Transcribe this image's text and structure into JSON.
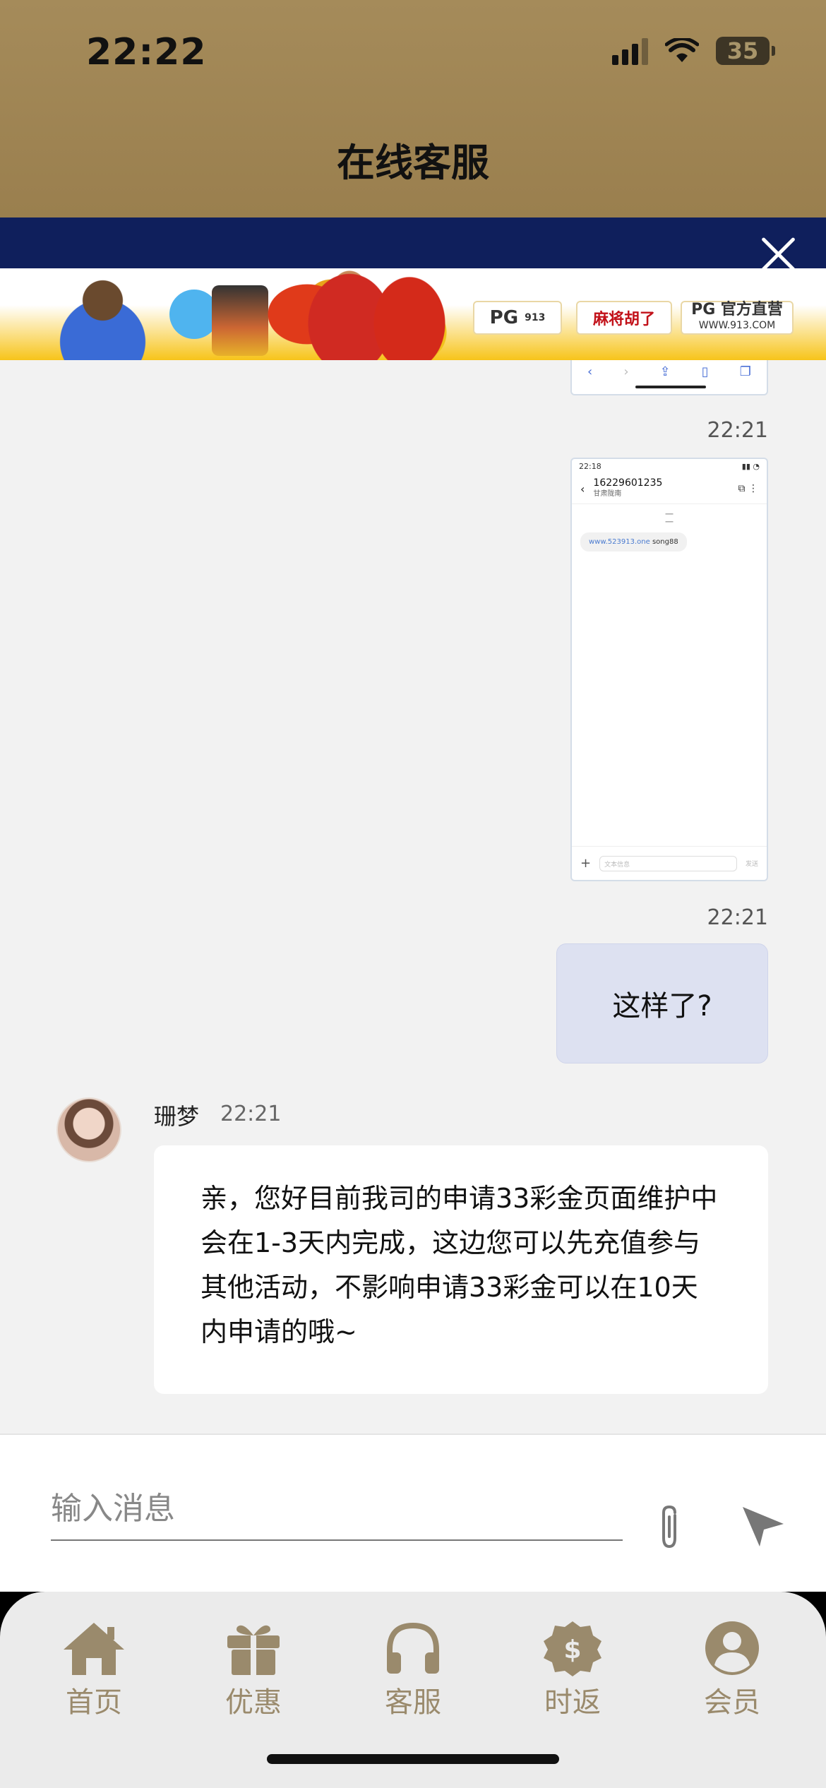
{
  "status_bar": {
    "time": "22:22",
    "battery": "35"
  },
  "header": {
    "title": "在线客服"
  },
  "banner": {
    "tag1": "PG",
    "tag1_sub": "913",
    "tag2": "麻将胡了",
    "tag3": "PG 官方直营",
    "tag3_sub": "WWW.913.COM"
  },
  "chat": {
    "messages": [
      {
        "type": "image",
        "time": "22:21",
        "screenshot": {
          "status_time": "22:18",
          "number": "16229601235",
          "location": "甘肃陇南",
          "link": "www.523913.one",
          "code": "song88",
          "input_placeholder": "文本信息",
          "send": "发送"
        }
      },
      {
        "type": "text",
        "direction": "out",
        "time": "22:21",
        "text": "这样了?"
      },
      {
        "type": "text",
        "direction": "in",
        "sender": "珊梦",
        "time": "22:21",
        "text": "亲，您好目前我司的申请33彩金页面维护中会在1-3天内完成，这边您可以先充值参与其他活动，不影响申请33彩金可以在10天内申请的哦~"
      }
    ]
  },
  "composer": {
    "placeholder": "输入消息"
  },
  "nav": {
    "items": [
      {
        "label": "首页",
        "icon": "home-icon"
      },
      {
        "label": "优惠",
        "icon": "gift-icon"
      },
      {
        "label": "客服",
        "icon": "headphones-icon"
      },
      {
        "label": "时返",
        "icon": "dollar-badge-icon"
      },
      {
        "label": "会员",
        "icon": "user-icon"
      }
    ],
    "color": "#9a8a6c"
  },
  "colors": {
    "header": "#a58b5a",
    "ad_bar": "#0f1f5c",
    "out_bubble": "#dde1f1"
  }
}
